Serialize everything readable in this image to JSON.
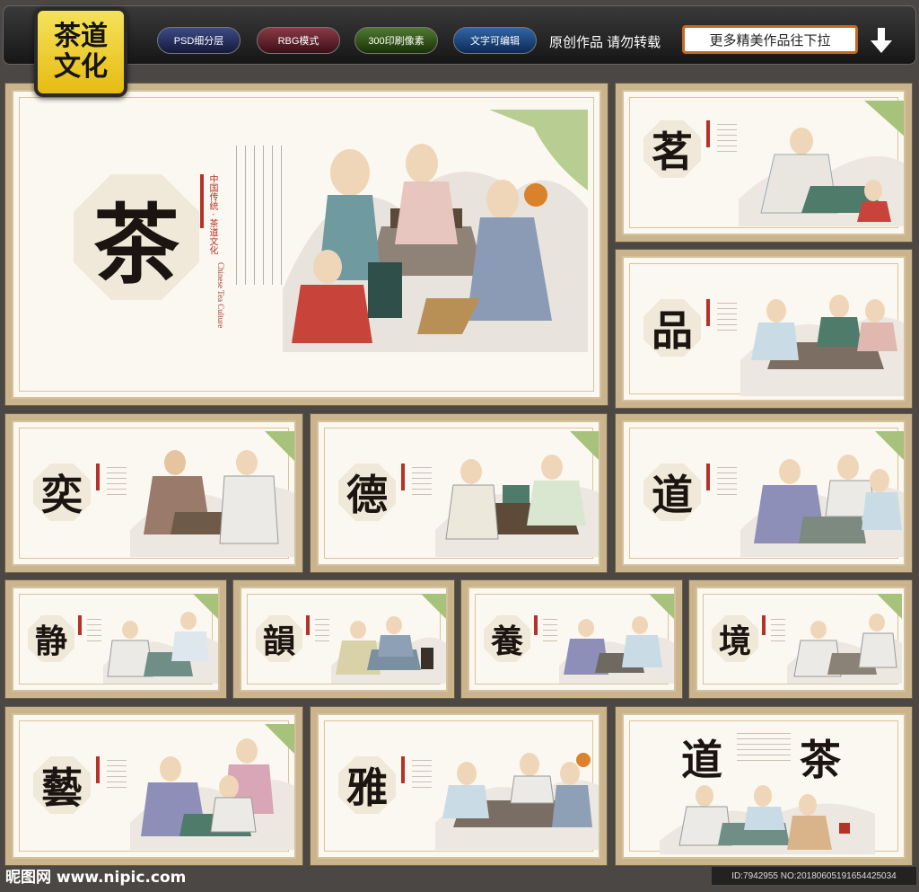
{
  "toolbar": {
    "logo_line1": "茶道",
    "logo_line2": "文化",
    "pills": [
      "PSD细分层",
      "RBG模式",
      "300印刷像素",
      "文字可编辑"
    ],
    "notice": "原创作品 请勿转载",
    "more_label": "更多精美作品往下拉"
  },
  "main_panel": {
    "char": "茶",
    "vertical_cn": "中国传统 · 茶道文化",
    "vertical_en": "Chinese Tea Culture"
  },
  "panels": [
    "茗",
    "品",
    "奕",
    "德",
    "道",
    "静",
    "韻",
    "養",
    "境",
    "藝",
    "雅"
  ],
  "last_panel": {
    "char_left": "道",
    "char_right": "茶"
  },
  "footer": {
    "watermark": "昵图网 www.nipic.com",
    "id_text": "ID:7942955 NO:20180605191654425034"
  },
  "colors": {
    "frame": "#c9b48e",
    "seal_red": "#b5322b",
    "accent": "#c06a22"
  }
}
